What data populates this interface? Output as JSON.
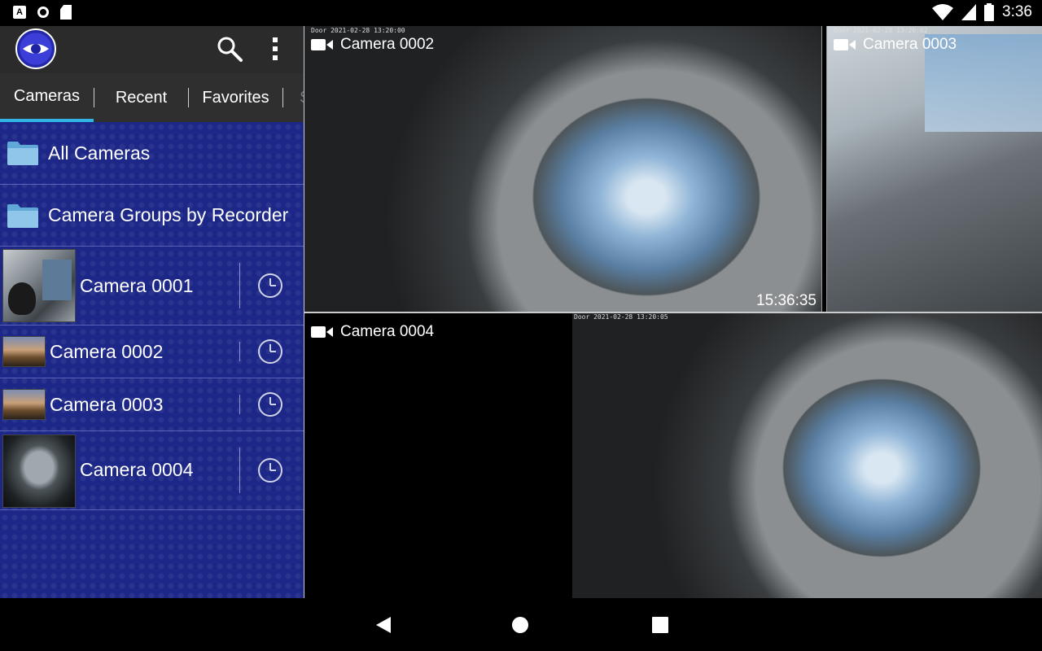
{
  "status_bar": {
    "left_icons": [
      "notification-a-icon",
      "record-circle-icon",
      "sd-card-icon"
    ],
    "right_icons": [
      "wifi-icon",
      "cell-signal-icon",
      "battery-icon"
    ],
    "time": "3:36",
    "notification_letter": "A"
  },
  "app_bar": {
    "logo": "eye-logo-icon",
    "search_icon": "search-icon",
    "menu_icon": "overflow-menu-icon"
  },
  "tabs": [
    {
      "label": "Cameras",
      "active": true
    },
    {
      "label": "Recent",
      "active": false
    },
    {
      "label": "Favorites",
      "active": false
    },
    {
      "label": "S",
      "active": false
    }
  ],
  "list": {
    "folders": [
      {
        "label": "All Cameras",
        "icon": "folder-icon"
      },
      {
        "label": "Camera Groups by Recorder",
        "icon": "folder-icon"
      }
    ],
    "cameras": [
      {
        "label": "Camera 0001",
        "icon": "clock-icon"
      },
      {
        "label": "Camera 0002",
        "icon": "clock-icon"
      },
      {
        "label": "Camera 0003",
        "icon": "clock-icon"
      },
      {
        "label": "Camera 0004",
        "icon": "clock-icon"
      }
    ]
  },
  "video_tiles": [
    {
      "title": "Camera 0002",
      "overlay_time": "15:36:35",
      "osd": "Door 2021-02-28 13:20:00"
    },
    {
      "title": "Camera 0003",
      "osd": "Door 2021-02-28 13:20:02"
    },
    {
      "title": "Camera 0004",
      "osd": "Door 2021-02-28 13:20:05"
    }
  ],
  "nav_bar": {
    "back": "back-triangle-icon",
    "home": "home-circle-icon",
    "recents": "recents-square-icon"
  },
  "colors": {
    "panel_blue": "#1b2585",
    "tab_underline": "#33b5e5",
    "appbar": "#2b2b2b"
  }
}
